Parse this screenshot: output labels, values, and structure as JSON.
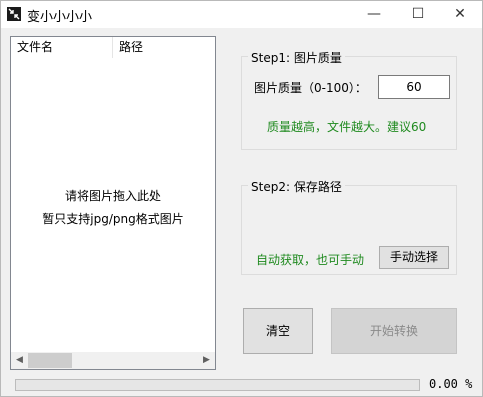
{
  "window": {
    "title": "变小小小小",
    "controls": {
      "minimize": "—",
      "maximize": "☐",
      "close": "✕"
    }
  },
  "file_list": {
    "columns": [
      "文件名",
      "路径"
    ],
    "hint_line1": "请将图片拖入此处",
    "hint_line2": "暂只支持jpg/png格式图片"
  },
  "step1": {
    "title": "Step1: 图片质量",
    "quality_label": "图片质量（0-100）：",
    "quality_value": "60",
    "tip": "质量越高，文件越大。建议60"
  },
  "step2": {
    "title": "Step2: 保存路径",
    "auto_text": "自动获取，也可手动",
    "manual_button": "手动选择"
  },
  "actions": {
    "clear_button": "清空",
    "convert_button": "开始转换"
  },
  "progress": {
    "percent": 0,
    "text": "0.00 %",
    "color": "#06b025"
  },
  "colors": {
    "tip_green": "#1f8a1f"
  },
  "icons": {
    "app": "compress-arrows-icon"
  }
}
